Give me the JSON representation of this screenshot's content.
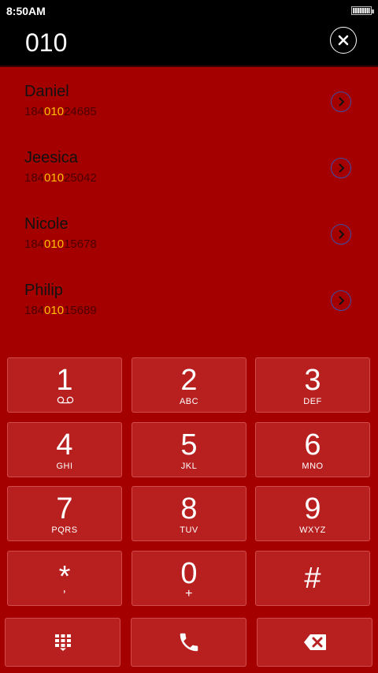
{
  "status_bar": {
    "time": "8:50AM"
  },
  "dialer": {
    "number": "010"
  },
  "contacts": [
    {
      "name": "Daniel",
      "phone_prefix": "184",
      "phone_match": "010",
      "phone_suffix": "24685"
    },
    {
      "name": "Jeesica",
      "phone_prefix": "184",
      "phone_match": "010",
      "phone_suffix": "25042"
    },
    {
      "name": "Nicole",
      "phone_prefix": "184",
      "phone_match": "010",
      "phone_suffix": "15678"
    },
    {
      "name": "Philip",
      "phone_prefix": "184",
      "phone_match": "010",
      "phone_suffix": "15689"
    }
  ],
  "keypad": [
    {
      "digit": "1",
      "letters": ""
    },
    {
      "digit": "2",
      "letters": "ABC"
    },
    {
      "digit": "3",
      "letters": "DEF"
    },
    {
      "digit": "4",
      "letters": "GHI"
    },
    {
      "digit": "5",
      "letters": "JKL"
    },
    {
      "digit": "6",
      "letters": "MNO"
    },
    {
      "digit": "7",
      "letters": "PQRS"
    },
    {
      "digit": "8",
      "letters": "TUV"
    },
    {
      "digit": "9",
      "letters": "WXYZ"
    },
    {
      "digit": "*",
      "letters": ","
    },
    {
      "digit": "0",
      "letters": "+"
    },
    {
      "digit": "#",
      "letters": ""
    }
  ],
  "icons": {
    "clear": "close-icon",
    "contact_arrow": "chevron-right-icon",
    "voicemail": "voicemail-icon",
    "dialpad": "dialpad-icon",
    "call": "phone-icon",
    "backspace": "backspace-icon"
  },
  "colors": {
    "background": "#a50000",
    "key": "#b82020",
    "match_highlight": "#ffc000",
    "arrow": "#3b4fa8"
  }
}
